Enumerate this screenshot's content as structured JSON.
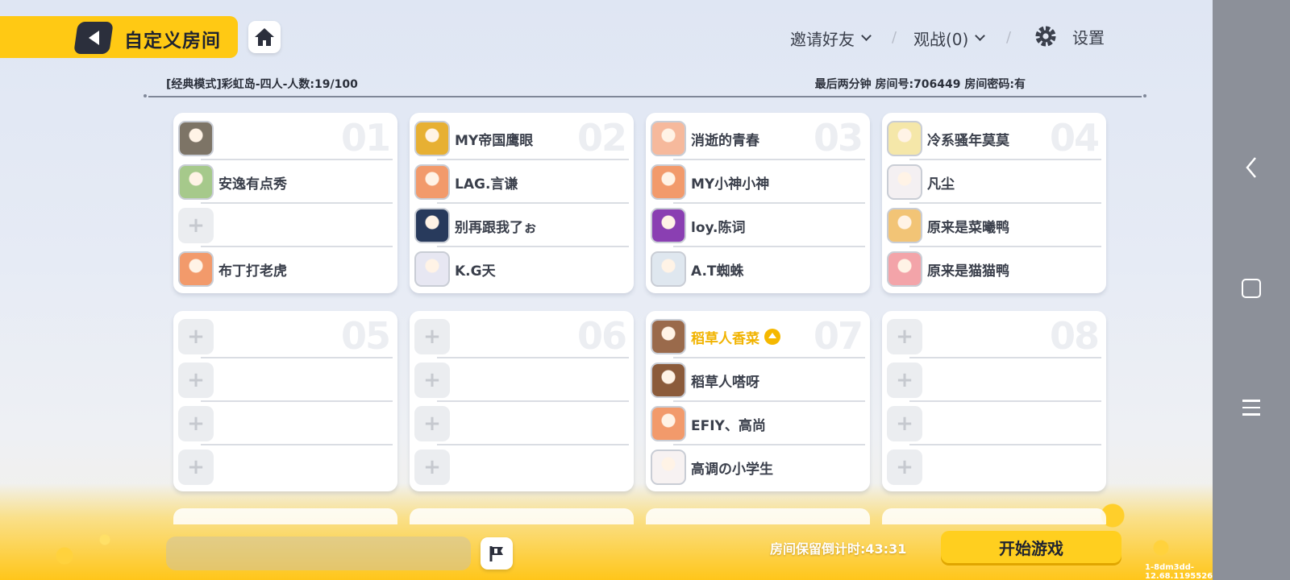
{
  "header": {
    "title": "自定义房间",
    "invite_label": "邀请好友",
    "spectate_label": "观战(0)",
    "settings_label": "设置"
  },
  "room_info": {
    "mode_text": "[经典模式]彩虹岛-四人-人数:19/100",
    "meta_text": "最后两分钟 房间号:706449 房间密码:有"
  },
  "teams": [
    {
      "number": "01",
      "players": [
        {
          "name": "",
          "avatar": "cat-photo-avatar",
          "empty": false
        },
        {
          "name": "安逸有点秀",
          "avatar": "bear-avatar",
          "empty": false
        },
        {
          "name": "",
          "empty": true
        },
        {
          "name": "布丁打老虎",
          "avatar": "tiger-avatar",
          "empty": false
        }
      ]
    },
    {
      "number": "02",
      "players": [
        {
          "name": "MY帝国鹰眼",
          "avatar": "eagle-avatar",
          "empty": false
        },
        {
          "name": "LAG.言谦",
          "avatar": "tiger-avatar",
          "empty": false
        },
        {
          "name": "别再跟我了ぉ",
          "avatar": "dark-avatar",
          "empty": false
        },
        {
          "name": "K.G天",
          "avatar": "anime-avatar",
          "empty": false
        }
      ]
    },
    {
      "number": "03",
      "players": [
        {
          "name": "消逝的青春",
          "avatar": "girl-avatar",
          "empty": false
        },
        {
          "name": "MY小神小神",
          "avatar": "tiger-avatar",
          "empty": false
        },
        {
          "name": "loy.陈词",
          "avatar": "purple-avatar",
          "empty": false
        },
        {
          "name": "A.T蜘蛛",
          "avatar": "shark-avatar",
          "empty": false
        }
      ]
    },
    {
      "number": "04",
      "players": [
        {
          "name": "冷系骚年莫莫",
          "avatar": "cat-avatar",
          "empty": false
        },
        {
          "name": "凡尘",
          "avatar": "white-girl-avatar",
          "empty": false
        },
        {
          "name": "原来是菜曦鸭",
          "avatar": "blonde-avatar",
          "empty": false
        },
        {
          "name": "原来是猫猫鸭",
          "avatar": "pink-avatar",
          "empty": false
        }
      ]
    },
    {
      "number": "05",
      "players": [
        {
          "name": "",
          "empty": true
        },
        {
          "name": "",
          "empty": true
        },
        {
          "name": "",
          "empty": true
        },
        {
          "name": "",
          "empty": true
        }
      ]
    },
    {
      "number": "06",
      "players": [
        {
          "name": "",
          "empty": true
        },
        {
          "name": "",
          "empty": true
        },
        {
          "name": "",
          "empty": true
        },
        {
          "name": "",
          "empty": true
        }
      ]
    },
    {
      "number": "07",
      "players": [
        {
          "name": "稻草人香菜",
          "avatar": "scarecrow-avatar",
          "empty": false,
          "host": true
        },
        {
          "name": "稻草人嗒呀",
          "avatar": "brown-girl-avatar",
          "empty": false
        },
        {
          "name": "EFIY、高尚",
          "avatar": "tiger-avatar",
          "empty": false
        },
        {
          "name": "高调の小学生",
          "avatar": "white-blob-avatar",
          "empty": false
        }
      ]
    },
    {
      "number": "08",
      "players": [
        {
          "name": "",
          "empty": true
        },
        {
          "name": "",
          "empty": true
        },
        {
          "name": "",
          "empty": true
        },
        {
          "name": "",
          "empty": true
        }
      ]
    }
  ],
  "empty_slot_glyph": "+",
  "footer": {
    "countdown_text": "房间保留倒计时:43:31",
    "start_label": "开始游戏",
    "version_text": "1-8dm3dd-12.68.1195526"
  },
  "colors": {
    "accent_yellow": "#ffc914",
    "host_name": "#f1b300",
    "sidebar": "#8c9099"
  }
}
